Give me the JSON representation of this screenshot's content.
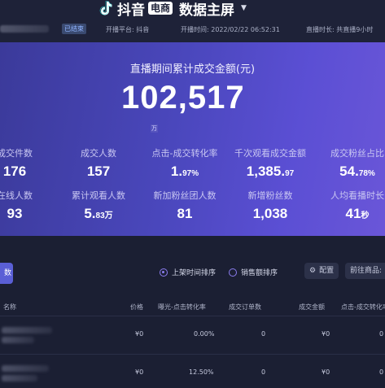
{
  "header": {
    "brand_name": "抖音",
    "brand_badge": "电商",
    "title": "数据主屏",
    "status_badge": "已结束",
    "platform": "开播平台: 抖音",
    "start_time": "开播时间: 2022/02/22 06:52:31",
    "duration": "直播时长: 共直播9小时"
  },
  "hero": {
    "title": "直播期间累计成交金额(元)",
    "total": "102,517",
    "unit": "万"
  },
  "stats_row1": [
    {
      "label": "成交件数",
      "value": "176",
      "suffix": ""
    },
    {
      "label": "成交人数",
      "value": "157",
      "suffix": ""
    },
    {
      "label": "点击-成交转化率",
      "value": "1.",
      "suffix": "97%"
    },
    {
      "label": "千次观看成交金额",
      "value": "1,385.",
      "suffix": "97"
    },
    {
      "label": "成交粉丝占比",
      "value": "54.",
      "suffix": "78%"
    }
  ],
  "stats_row2": [
    {
      "label": "在线人数",
      "value": "93",
      "suffix": ""
    },
    {
      "label": "累计观看人数",
      "value": "5.",
      "suffix": "83万"
    },
    {
      "label": "新加粉丝团人数",
      "value": "81",
      "suffix": ""
    },
    {
      "label": "新增粉丝数",
      "value": "1,038",
      "suffix": ""
    },
    {
      "label": "人均看播时长",
      "value": "41",
      "suffix": "秒"
    }
  ],
  "panel": {
    "tab_label": "数",
    "sort_options": [
      "上架时间排序",
      "销售额排序"
    ],
    "selected_sort": "上架时间排序",
    "config_label": "配置",
    "goto_label": "前往商品:"
  },
  "table": {
    "columns": [
      "名称",
      "价格",
      "曝光-点击转化率",
      "成交订单数",
      "成交金额",
      "点击-成交转化率"
    ],
    "rows": [
      {
        "price": "¥0",
        "ctr": "0.00%",
        "orders": "0",
        "amount": "¥0",
        "conv": "0"
      },
      {
        "price": "¥0",
        "ctr": "12.50%",
        "orders": "0",
        "amount": "¥0",
        "conv": "0"
      }
    ]
  },
  "colors": {
    "hero_gradient_start": "#3b3a9a",
    "hero_gradient_end": "#6a56d8",
    "page_bg": "#1b1f33",
    "accent": "#8c7df0"
  },
  "icons": [
    "tiktok-icon",
    "chevron-down-icon",
    "radio-icon",
    "settings-icon"
  ]
}
